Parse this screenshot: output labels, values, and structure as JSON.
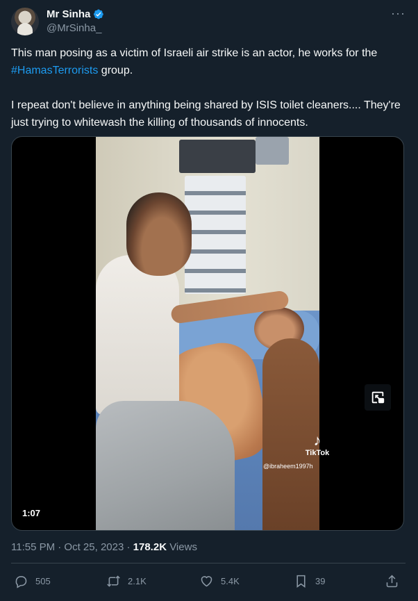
{
  "author": {
    "display_name": "Mr Sinha",
    "handle": "@MrSinha_",
    "verified": true,
    "verified_color": "#1d9bf0"
  },
  "more_icon": "more-horizontal-icon",
  "tweet": {
    "line1_before": "This man posing as a victim of Israeli air strike is an actor, he works for the ",
    "hashtag": "#HamasTerrorists",
    "line1_after": " group.",
    "paragraph2": "I repeat don't believe in anything being shared by ISIS toilet cleaners.... They're just trying to whitewash the killing of thousands of innocents."
  },
  "media": {
    "duration": "1:07",
    "watermark_brand": "TikTok",
    "watermark_user": "@ibraheem1997h",
    "pip_icon": "picture-in-picture-icon"
  },
  "meta": {
    "timestamp": "11:55 PM · Oct 25, 2023 · ",
    "views_count": "178.2K",
    "views_label": " Views"
  },
  "actions": {
    "replies": "505",
    "retweets": "2.1K",
    "likes": "5.4K",
    "bookmarks": "39"
  },
  "colors": {
    "background": "#15202b",
    "text": "#f7f9f9",
    "secondary": "#8b98a5",
    "link": "#1d9bf0",
    "border": "#38444d"
  }
}
